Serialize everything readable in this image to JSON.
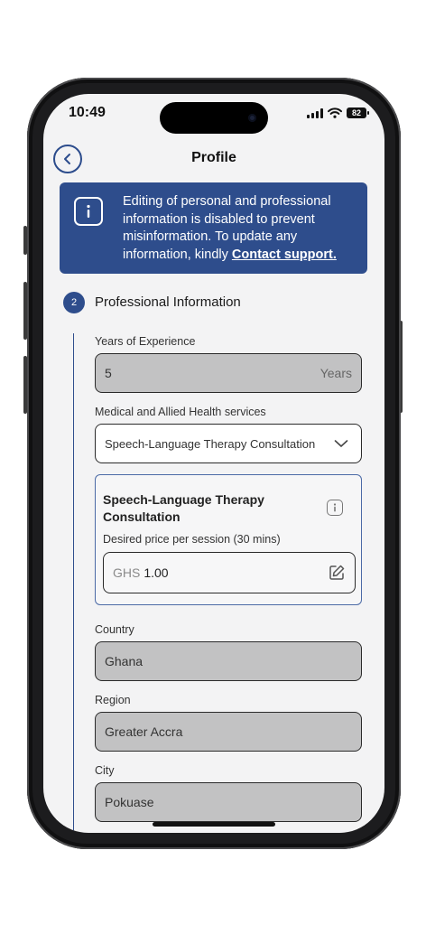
{
  "status_bar": {
    "time": "10:49",
    "battery": "82"
  },
  "header": {
    "title": "Profile"
  },
  "banner": {
    "text": "Editing of personal and professional information is disabled to prevent misinformation. To update any information, kindly",
    "link": "Contact support."
  },
  "section": {
    "number": "2",
    "title": "Professional Information"
  },
  "experience": {
    "label": "Years of Experience",
    "value": "5",
    "suffix": "Years"
  },
  "services": {
    "label": "Medical and Allied Health services",
    "selected": "Speech-Language Therapy Consultation"
  },
  "service_card": {
    "title": "Speech-Language Therapy Consultation",
    "price_label": "Desired price per session (30 mins)",
    "currency": "GHS",
    "price": "1.00"
  },
  "country": {
    "label": "Country",
    "value": "Ghana"
  },
  "region": {
    "label": "Region",
    "value": "Greater Accra"
  },
  "city": {
    "label": "City",
    "value": "Pokuase"
  },
  "colors": {
    "primary": "#2e4d8c",
    "disabled_field": "#c2c2c3",
    "background": "#f3f3f4"
  }
}
